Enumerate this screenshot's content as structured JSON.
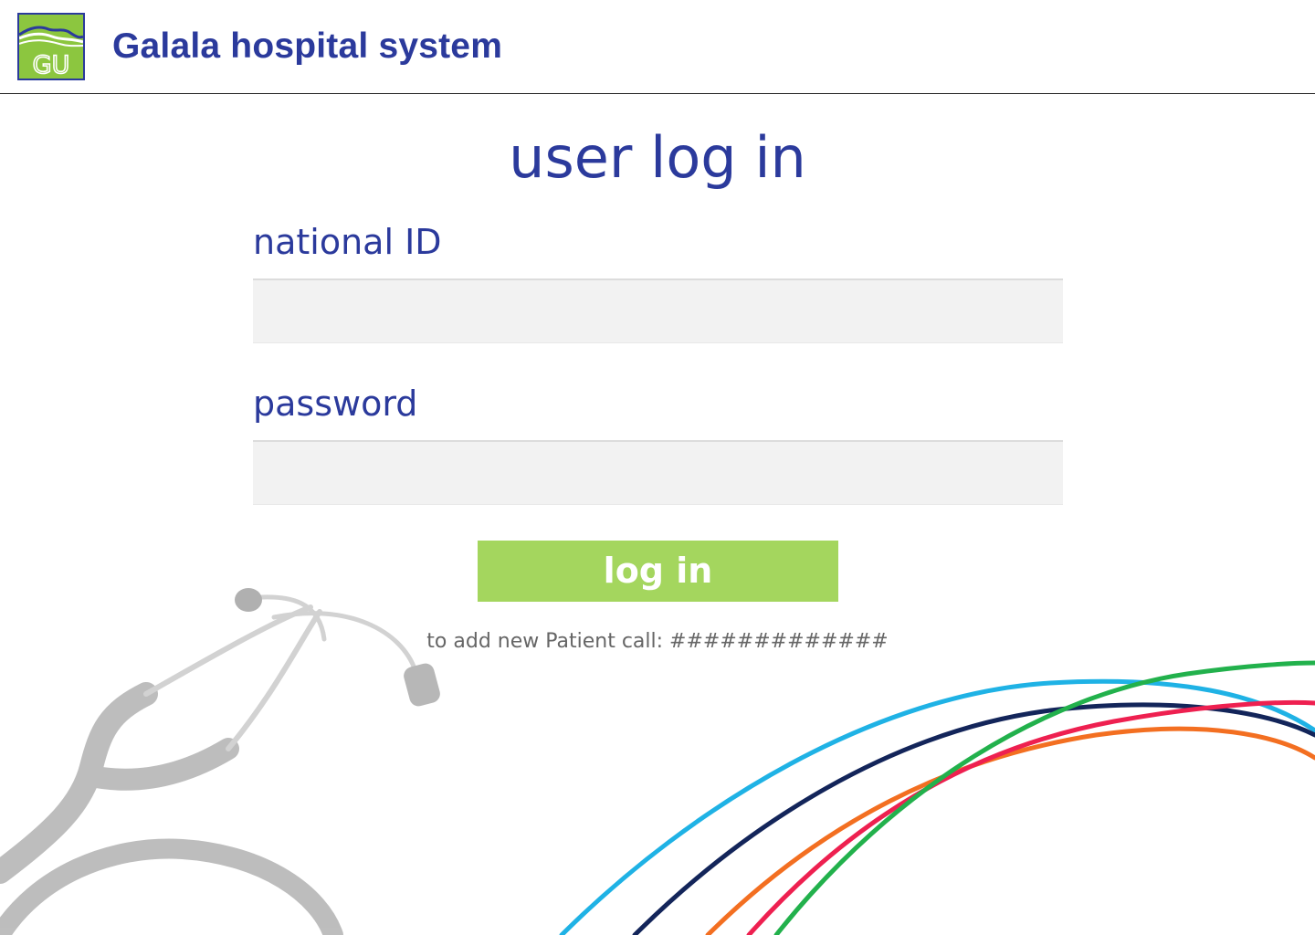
{
  "header": {
    "logo_text": "GU",
    "app_title": "Galala hospital system"
  },
  "main": {
    "title": "user log in",
    "national_id": {
      "label": "national ID",
      "value": "",
      "placeholder": ""
    },
    "password": {
      "label": "password",
      "value": "",
      "placeholder": ""
    },
    "login_button": "log in",
    "note": "to add new Patient call: #############"
  },
  "colors": {
    "brand_blue": "#2b3a9c",
    "button_green": "#a4d65e",
    "logo_green": "#8cc63f",
    "input_bg": "#f2f2f2"
  },
  "icons": {
    "logo": "galala-university-logo",
    "background_left": "stethoscope-image",
    "background_right": "colorful-arcs-image"
  }
}
